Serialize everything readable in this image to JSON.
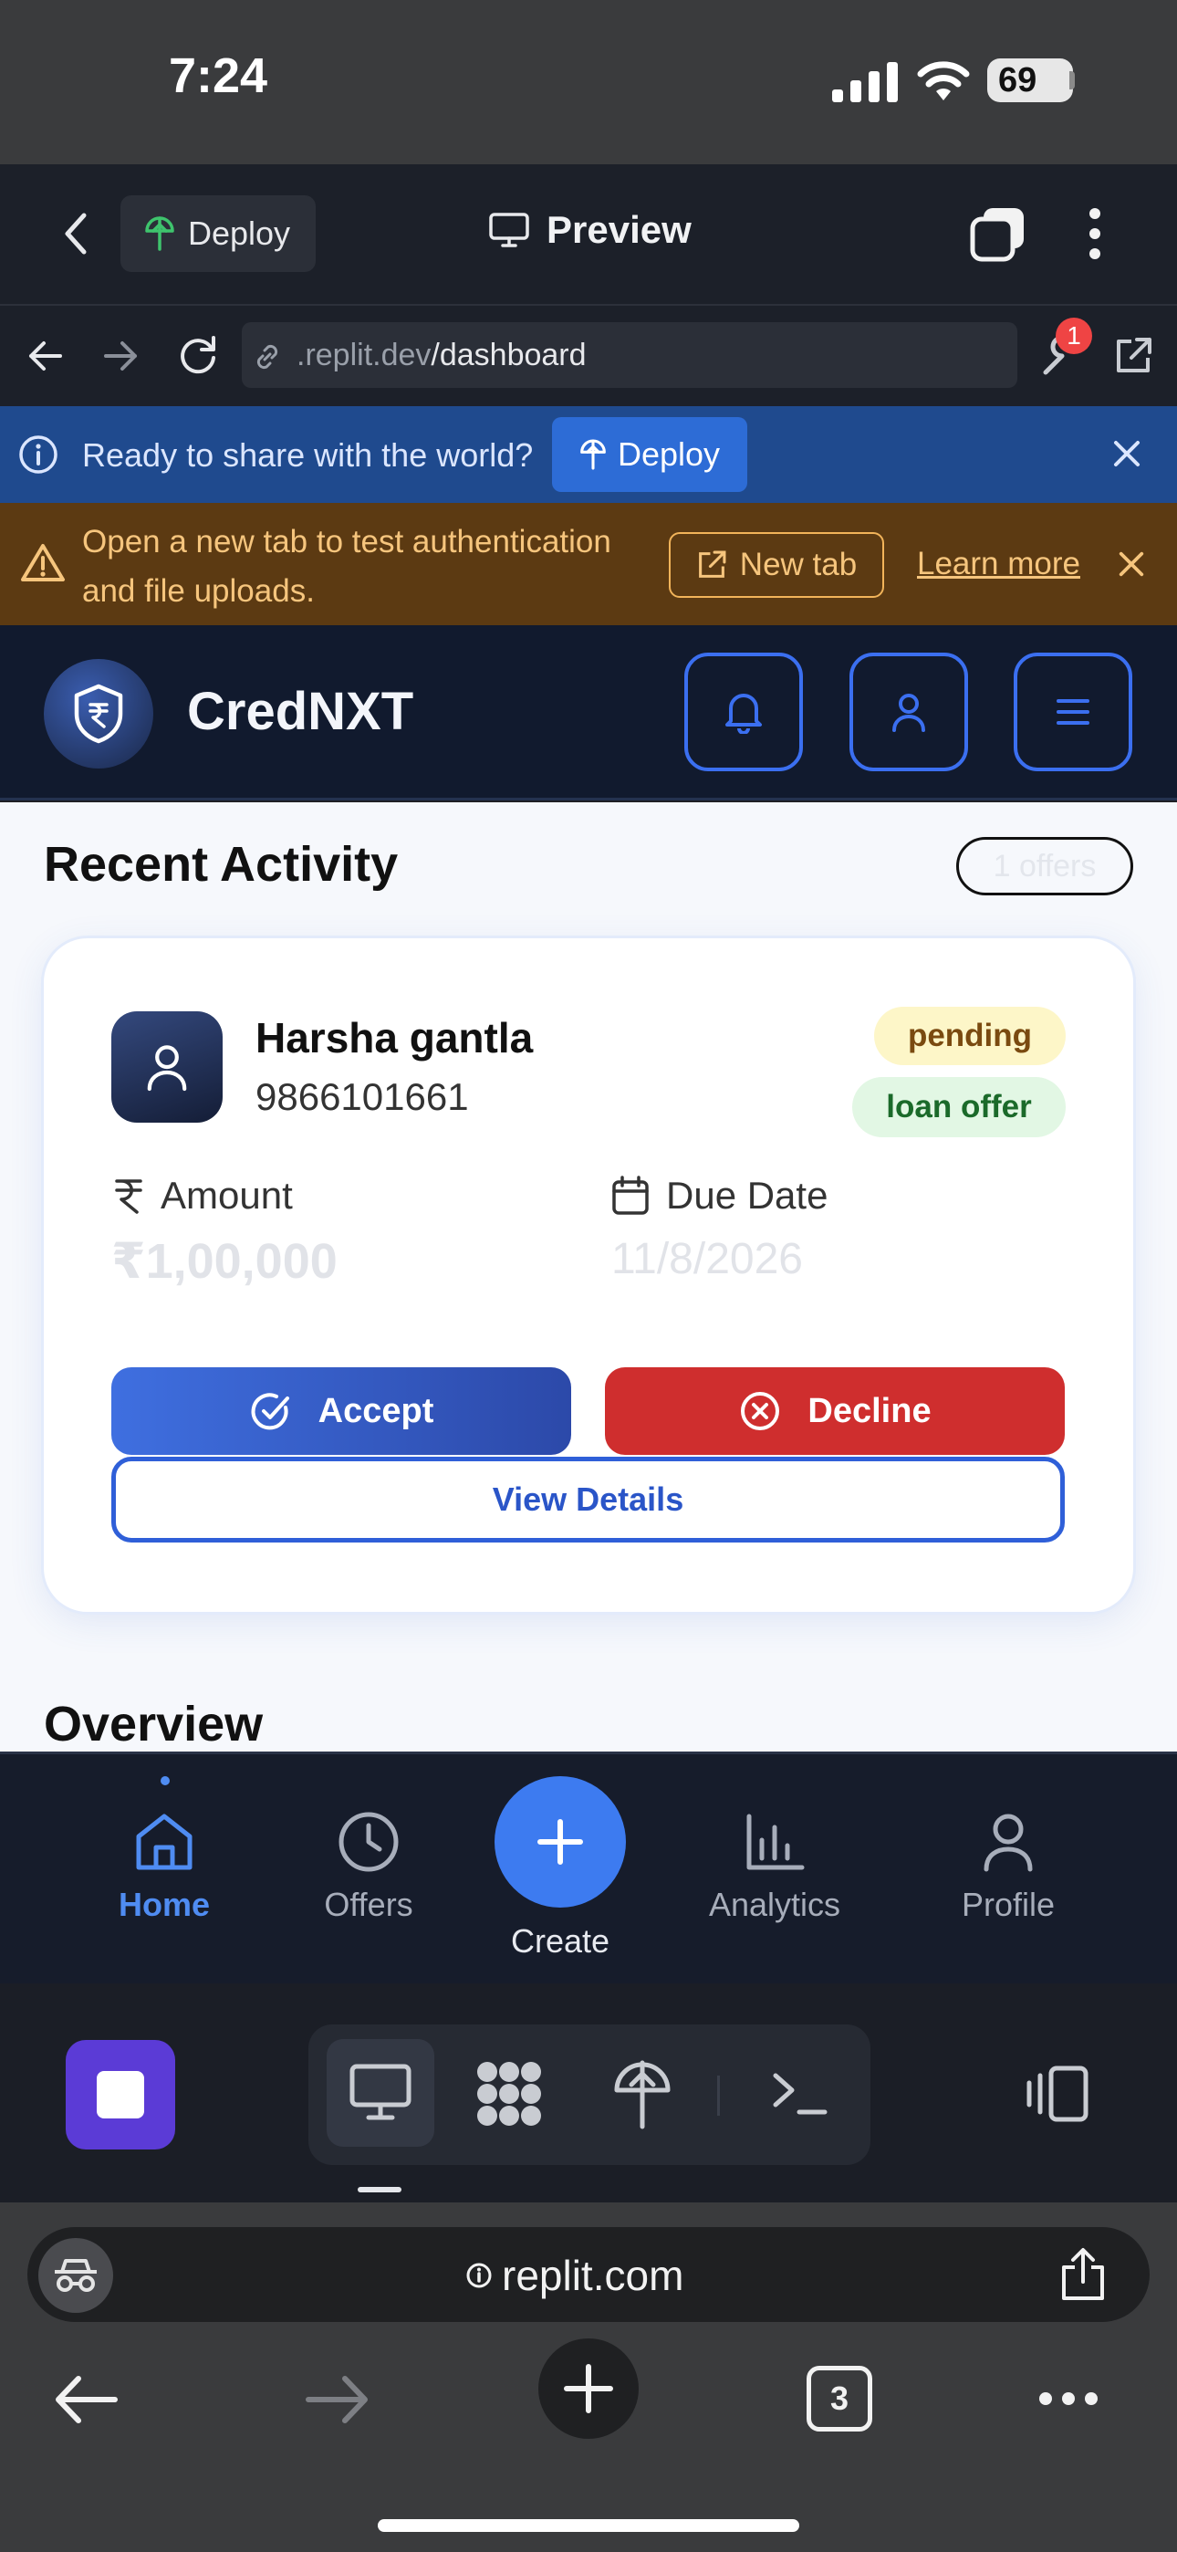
{
  "status_bar": {
    "time": "7:24",
    "battery": "69"
  },
  "replit_header": {
    "deploy_label": "Deploy",
    "preview_label": "Preview"
  },
  "url_bar": {
    "domain": ".replit.dev",
    "path": "/dashboard",
    "notification_count": "1"
  },
  "deploy_banner": {
    "text": "Ready to share with the world?",
    "button": "Deploy"
  },
  "auth_banner": {
    "text": "Open a new tab to test authentication and file uploads.",
    "new_tab": "New tab",
    "learn_more": "Learn more"
  },
  "app": {
    "brand": "CredNXT",
    "section_title": "Recent Activity",
    "offers_count": "1 offers",
    "card": {
      "name": "Harsha gantla",
      "phone": "9866101661",
      "status_badge": "pending",
      "type_badge": "loan offer",
      "amount_label": "Amount",
      "amount_value": "₹1,00,000",
      "due_label": "Due Date",
      "due_value": "11/8/2026",
      "accept": "Accept",
      "decline": "Decline",
      "view_details": "View Details"
    },
    "overview_title": "Overview"
  },
  "bottom_nav": {
    "items": [
      {
        "label": "Home"
      },
      {
        "label": "Offers"
      },
      {
        "label": "Create"
      },
      {
        "label": "Analytics"
      },
      {
        "label": "Profile"
      }
    ],
    "active": "Home"
  },
  "safari": {
    "url": "replit.com",
    "tab_count": "3"
  },
  "colors": {
    "accent": "#3d7bf0",
    "danger": "#cf2e2e",
    "app_bg": "#111a2e",
    "banner_blue": "#1f4a8e",
    "banner_orange": "#5c3a12"
  }
}
